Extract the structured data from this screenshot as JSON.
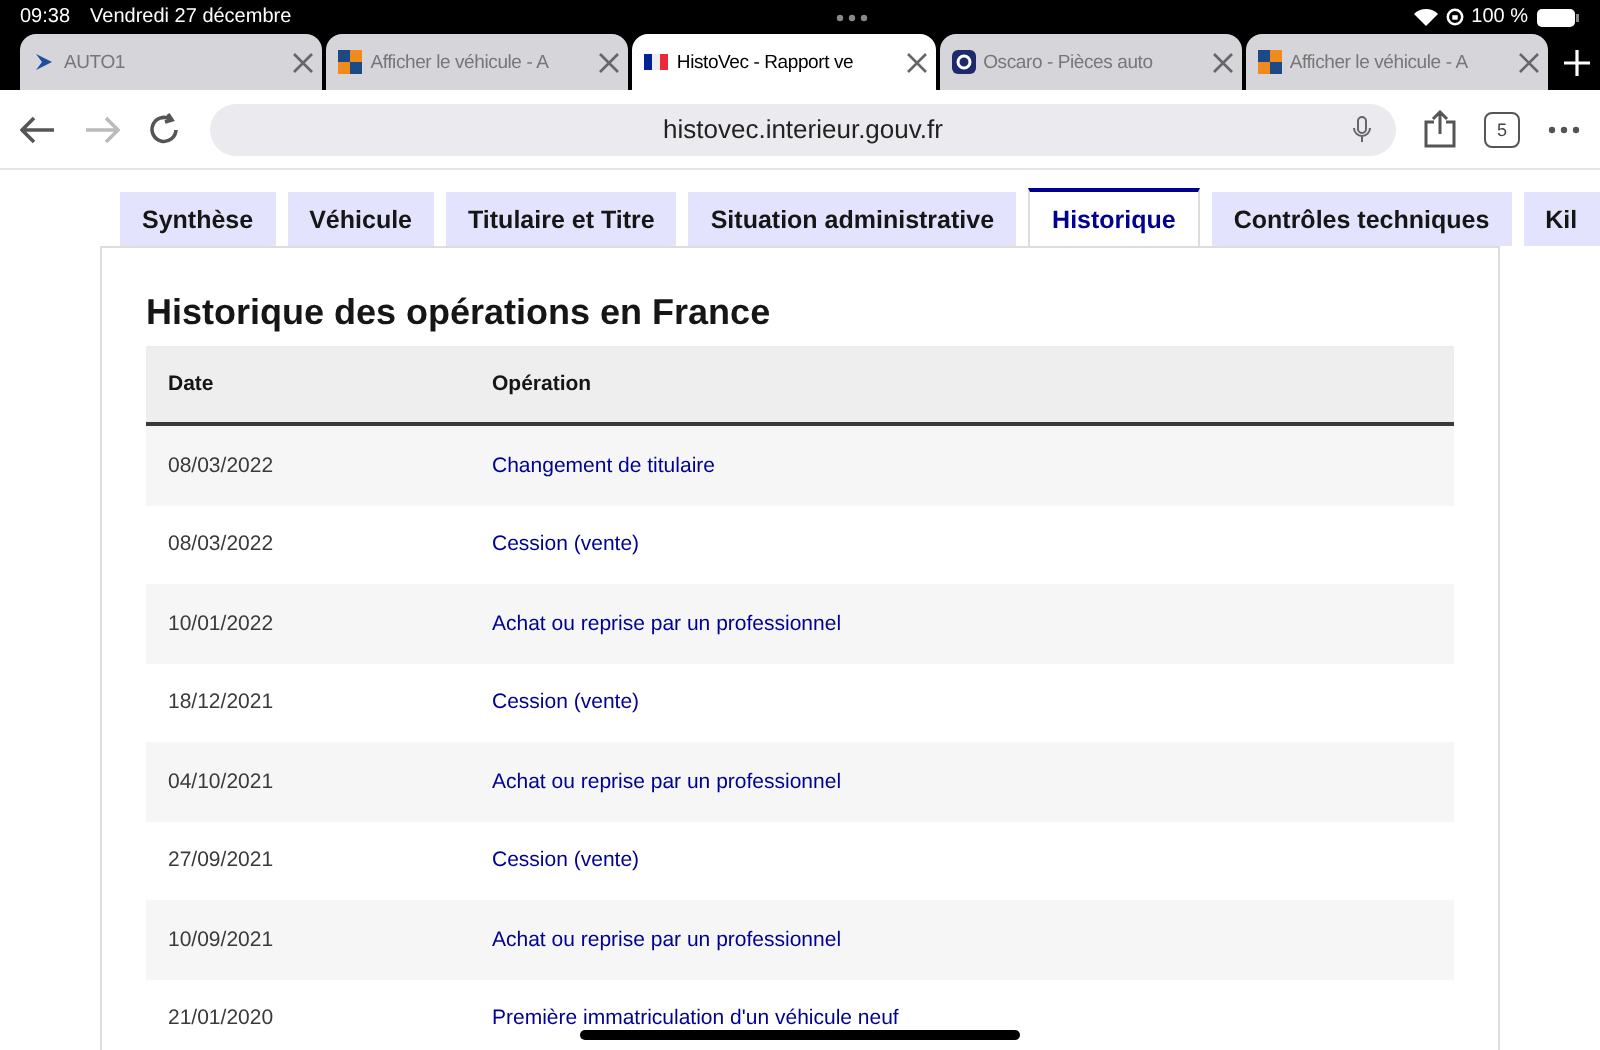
{
  "status_bar": {
    "time": "09:38",
    "date": "Vendredi 27 décembre",
    "battery": "100 %"
  },
  "browser_tabs": [
    {
      "title": "AUTO1",
      "kind": "auto",
      "selected": false
    },
    {
      "title": "Afficher le véhicule - A",
      "kind": "squares",
      "selected": false
    },
    {
      "title": "HistoVec - Rapport ve",
      "kind": "flag",
      "selected": true
    },
    {
      "title": "Oscaro - Pièces auto",
      "kind": "oscaro",
      "selected": false
    },
    {
      "title": "Afficher le véhicule - A",
      "kind": "squares",
      "selected": false
    }
  ],
  "toolbar": {
    "forward_disabled": true,
    "url": "histovec.interieur.gouv.fr",
    "tab_count": "5"
  },
  "page_tabs": [
    {
      "label": "Synthèse",
      "selected": false
    },
    {
      "label": "Véhicule",
      "selected": false
    },
    {
      "label": "Titulaire et Titre",
      "selected": false
    },
    {
      "label": "Situation administrative",
      "selected": false
    },
    {
      "label": "Historique",
      "selected": true
    },
    {
      "label": "Contrôles techniques",
      "selected": false
    },
    {
      "label": "Kil",
      "selected": false
    }
  ],
  "heading": "Historique des opérations en France",
  "table": {
    "columns": [
      "Date",
      "Opération"
    ],
    "rows": [
      [
        "08/03/2022",
        "Changement de titulaire"
      ],
      [
        "08/03/2022",
        "Cession (vente)"
      ],
      [
        "10/01/2022",
        "Achat ou reprise par un professionnel"
      ],
      [
        "18/12/2021",
        "Cession (vente)"
      ],
      [
        "04/10/2021",
        "Achat ou reprise par un professionnel"
      ],
      [
        "27/09/2021",
        "Cession (vente)"
      ],
      [
        "10/09/2021",
        "Achat ou reprise par un professionnel"
      ],
      [
        "21/01/2020",
        "Première immatriculation d'un véhicule neuf"
      ]
    ]
  }
}
